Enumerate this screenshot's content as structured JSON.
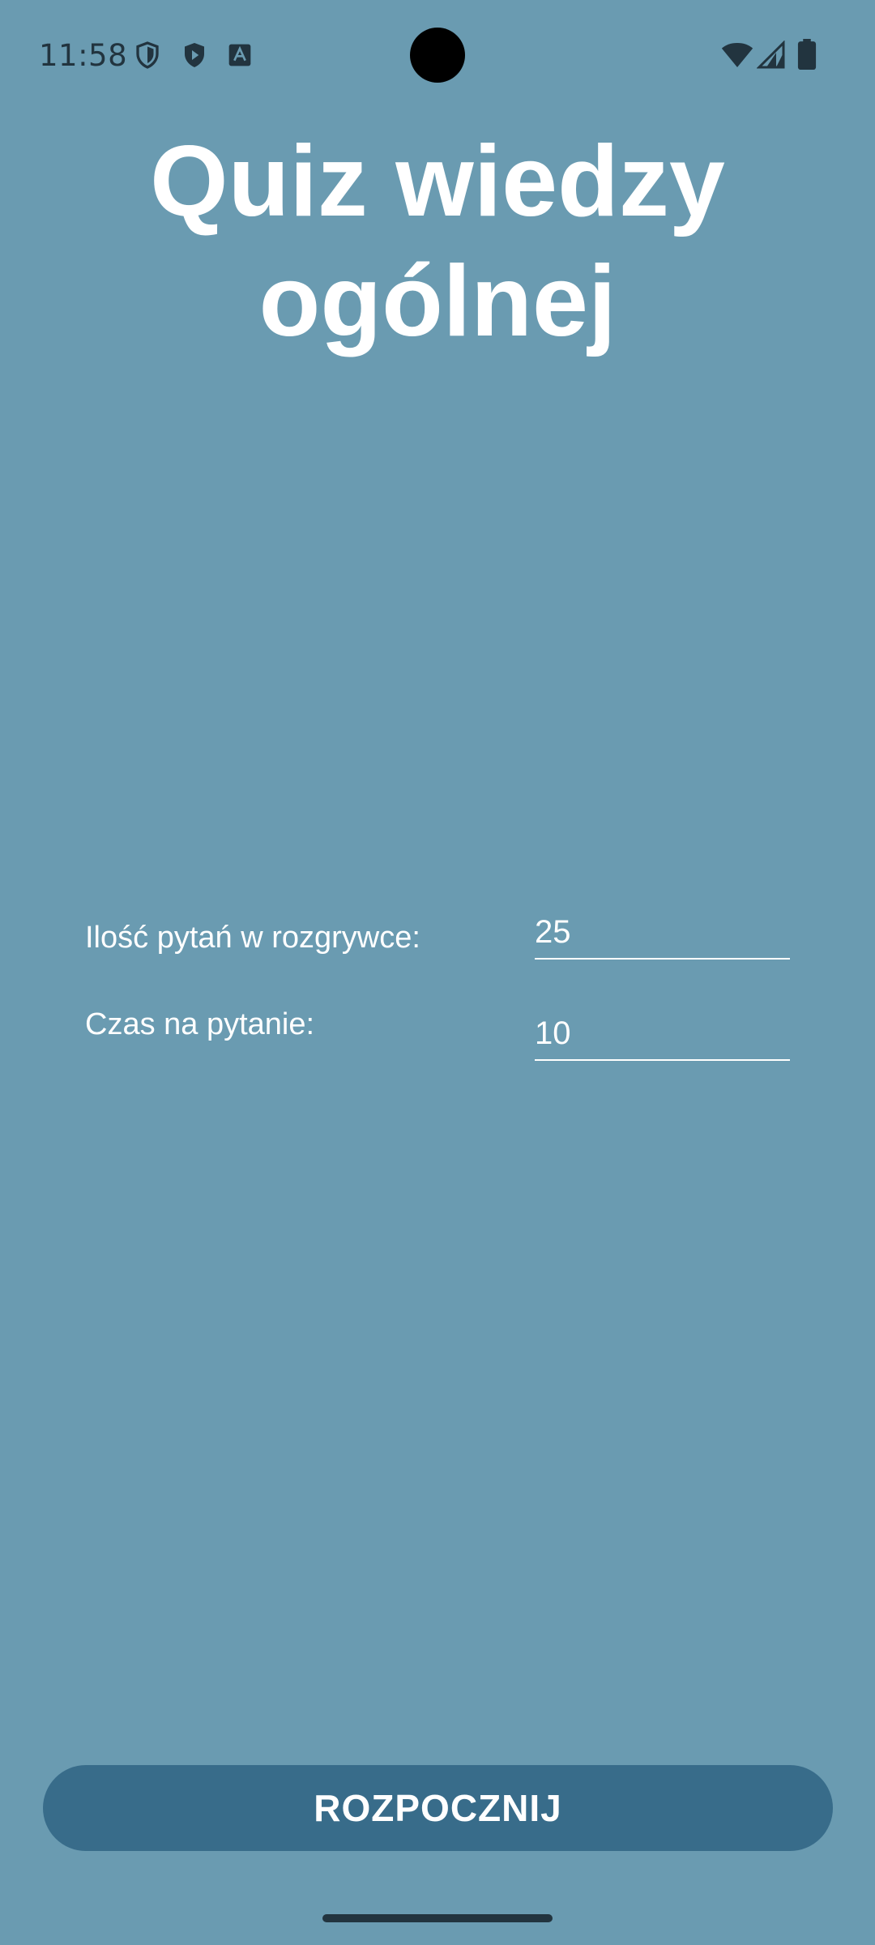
{
  "status_bar": {
    "time": "11:58",
    "left_icons": [
      "shield-outline-icon",
      "play-protect-icon",
      "translate-a-icon"
    ],
    "right_icons": [
      "wifi-icon",
      "cellular-signal-icon",
      "battery-icon"
    ],
    "icon_color": "#22343f"
  },
  "app": {
    "title_line1": "Quiz wiedzy",
    "title_line2": "ogólnej",
    "background_color": "#6a9bb1"
  },
  "form": {
    "questions_label": "Ilość pytań w rozgrywce:",
    "questions_value": "25",
    "time_label": "Czas na pytanie:",
    "time_value": "10"
  },
  "start_button": {
    "label": "ROZPOCZNIJ",
    "color": "#386c8a"
  }
}
